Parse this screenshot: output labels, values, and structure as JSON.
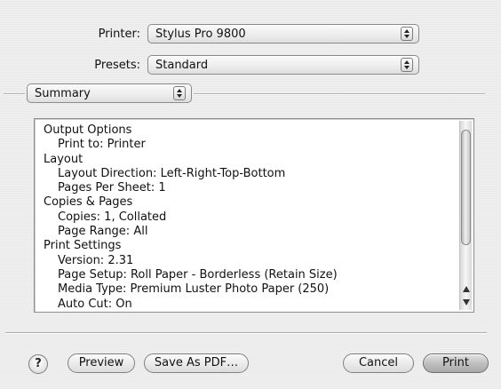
{
  "printer": {
    "label": "Printer:",
    "value": "Stylus Pro 9800"
  },
  "presets": {
    "label": "Presets:",
    "value": "Standard"
  },
  "panel": {
    "selected": "Summary"
  },
  "summary": {
    "lines": [
      {
        "text": "Output Options",
        "indent": 0
      },
      {
        "text": "Print to:  Printer",
        "indent": 1
      },
      {
        "text": "Layout",
        "indent": 0
      },
      {
        "text": "Layout Direction:  Left-Right-Top-Bottom",
        "indent": 1
      },
      {
        "text": "Pages Per Sheet:  1",
        "indent": 1
      },
      {
        "text": "Copies & Pages",
        "indent": 0
      },
      {
        "text": "Copies:  1, Collated",
        "indent": 1
      },
      {
        "text": "Page Range:  All",
        "indent": 1
      },
      {
        "text": "Print Settings",
        "indent": 0
      },
      {
        "text": "Version:  2.31",
        "indent": 1
      },
      {
        "text": "Page Setup:  Roll Paper - Borderless (Retain Size)",
        "indent": 1
      },
      {
        "text": "Media Type:  Premium Luster Photo Paper (250)",
        "indent": 1
      },
      {
        "text": "Auto Cut:  On",
        "indent": 1
      }
    ]
  },
  "buttons": {
    "help": "?",
    "preview": "Preview",
    "save_pdf": "Save As PDF…",
    "cancel": "Cancel",
    "print": "Print"
  },
  "icons": {
    "popup_arrows": "up-down-arrows-icon",
    "scroll_up": "scroll-up-arrow-icon",
    "scroll_down": "scroll-down-arrow-icon"
  }
}
